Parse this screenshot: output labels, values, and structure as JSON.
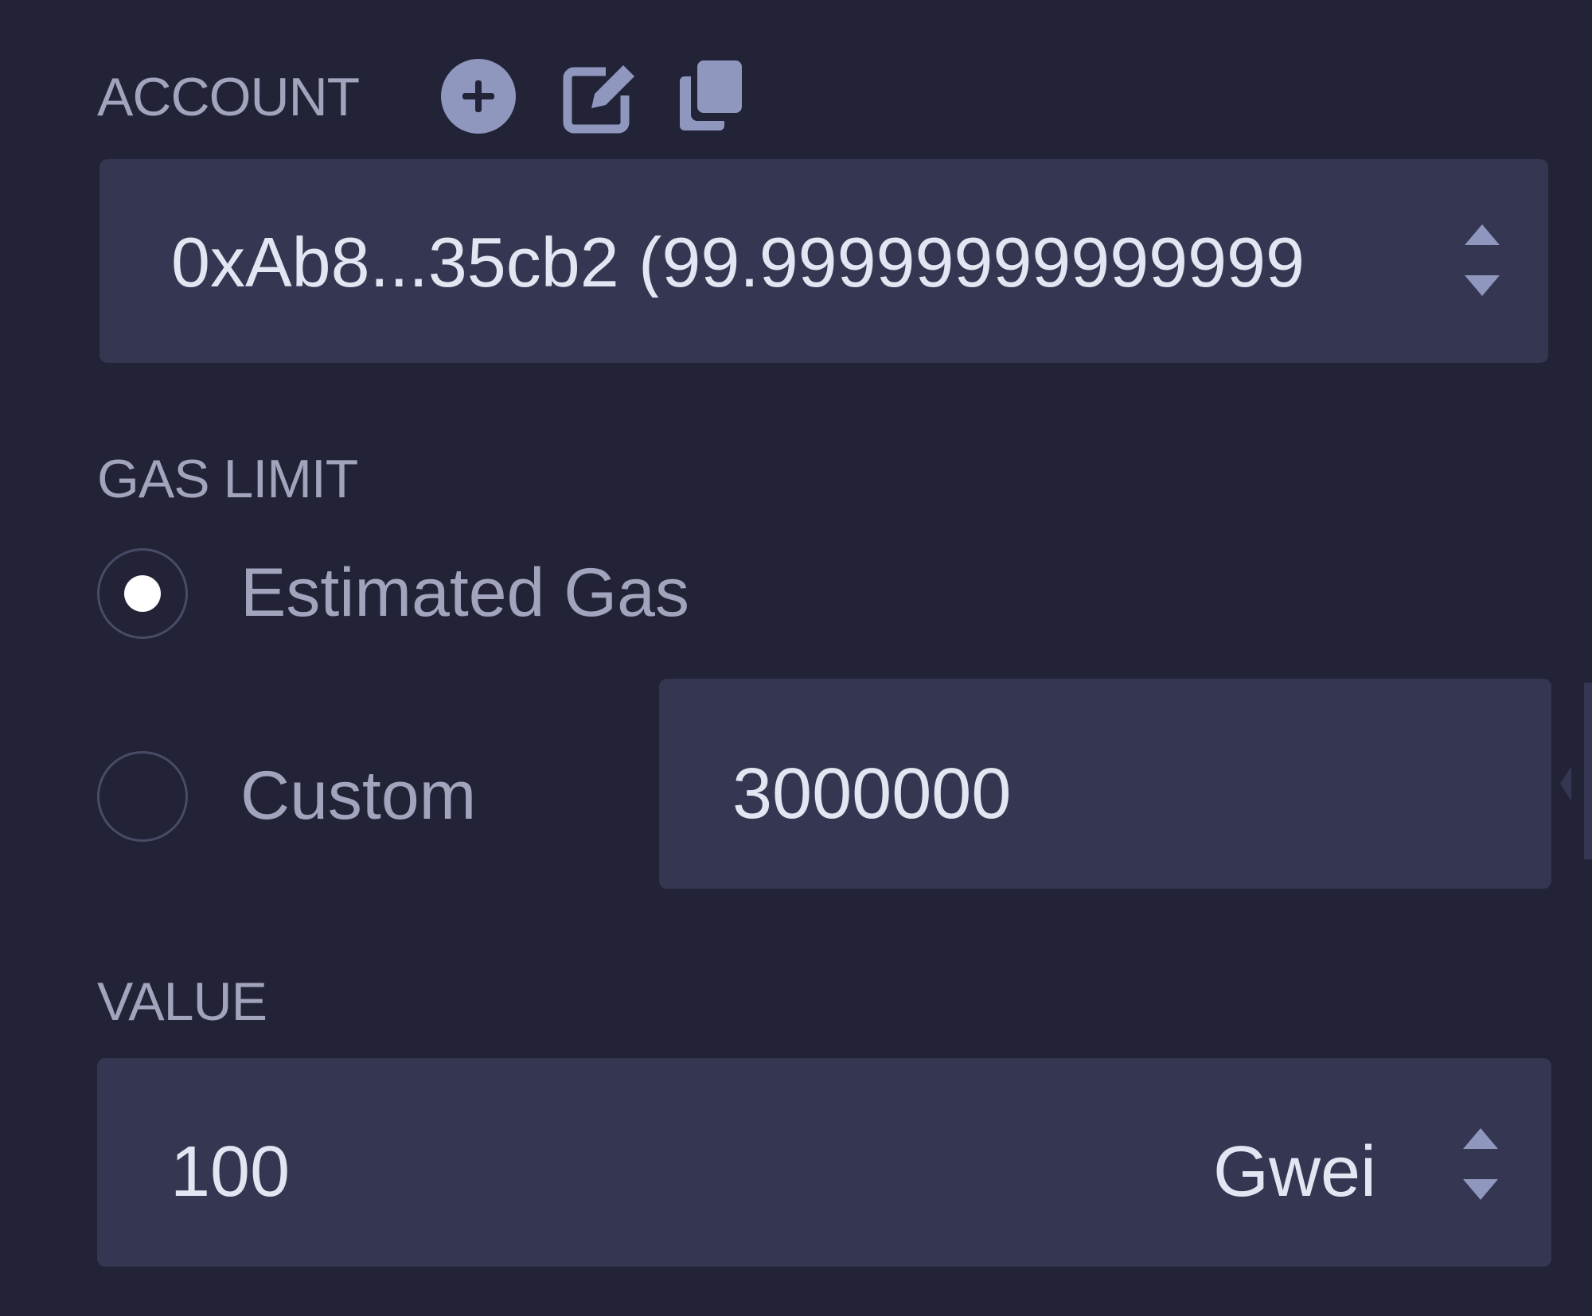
{
  "account": {
    "label": "ACCOUNT",
    "add_icon": "plus-circle-icon",
    "edit_icon": "edit-icon",
    "copy_icon": "copy-icon",
    "selected": "0xAb8...35cb2 (99.99999999999999"
  },
  "gas_limit": {
    "label": "GAS LIMIT",
    "options": [
      {
        "label": "Estimated Gas",
        "checked": true
      },
      {
        "label": "Custom",
        "checked": false
      }
    ],
    "custom_value": "3000000"
  },
  "value": {
    "label": "VALUE",
    "amount": "100",
    "unit": "Gwei"
  },
  "colors": {
    "background": "#222336",
    "field": "#353651",
    "icon": "#8f97be",
    "text": "#e4e5f2",
    "label": "#a2a3bd"
  }
}
